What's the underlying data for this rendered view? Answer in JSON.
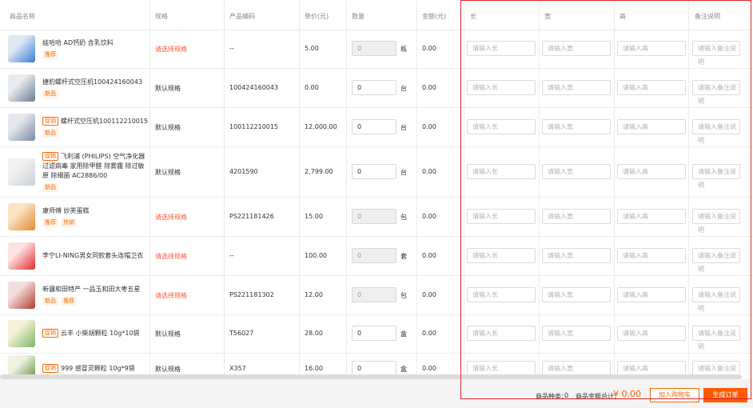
{
  "header": {
    "product_name": "商品名称",
    "spec": "规格",
    "product_code": "产品编码",
    "unit_price": "单价(元)",
    "quantity": "数量",
    "amount": "金额(元)",
    "length": "长",
    "width": "宽",
    "height": "高",
    "remark": "备注说明"
  },
  "placeholders": {
    "length": "请输入长",
    "width": "请输入宽",
    "height": "请输入高",
    "remark": "请输入备注说明"
  },
  "rows": [
    {
      "promo": "",
      "name": "娃哈哈 AD钙奶 含乳饮料",
      "badges": [
        "推荐"
      ],
      "spec": "请选择规格",
      "code": "--",
      "price": "5.00",
      "qty": "0",
      "unit": "瓶",
      "amount": "0.00"
    },
    {
      "promo": "",
      "name": "捷豹螺杆式空压机100424160043",
      "badges": [
        "新品"
      ],
      "spec": "默认规格",
      "code": "100424160043",
      "price": "0.00",
      "qty": "0",
      "unit": "台",
      "amount": "0.00"
    },
    {
      "promo": "促销",
      "name": "螺杆式空压机100112210015",
      "badges": [
        "新品"
      ],
      "spec": "默认规格",
      "code": "100112210015",
      "price": "12,000.00",
      "qty": "0",
      "unit": "台",
      "amount": "0.00"
    },
    {
      "promo": "促销",
      "name": "飞利浦 (PHILIPS) 空气净化器 过滤病毒 家用除甲醛 除雾霾 除过敏原 除细菌 AC2886/00",
      "badges": [
        "新品"
      ],
      "spec": "默认规格",
      "code": "4201590",
      "price": "2,799.00",
      "qty": "0",
      "unit": "台",
      "amount": "0.00"
    },
    {
      "promo": "",
      "name": "康师傅 妙芙蛋糕",
      "badges": [
        "推荐",
        "热销"
      ],
      "spec": "请选择规格",
      "code": "PS221181426",
      "price": "15.00",
      "qty": "0",
      "unit": "包",
      "amount": "0.00"
    },
    {
      "promo": "",
      "name": "李宁LI-NING男女同款套头连帽卫衣",
      "badges": [],
      "spec": "请选择规格",
      "code": "--",
      "price": "100.00",
      "qty": "0",
      "unit": "套",
      "amount": "0.00"
    },
    {
      "promo": "",
      "name": "新疆和田特产 一品玉和田大枣五星",
      "badges": [
        "新品",
        "推荐"
      ],
      "spec": "请选择规格",
      "code": "PS221181302",
      "price": "12.00",
      "qty": "0",
      "unit": "包",
      "amount": "0.00"
    },
    {
      "promo": "促销",
      "name": "云丰 小柴胡颗粒 10g*10袋",
      "badges": [],
      "spec": "默认规格",
      "code": "T56027",
      "price": "28.00",
      "qty": "0",
      "unit": "盒",
      "amount": "0.00"
    },
    {
      "promo": "促销",
      "name": "999 感冒灵颗粒 10g*9袋",
      "badges": [],
      "spec": "默认规格",
      "code": "X357",
      "price": "16.00",
      "qty": "0",
      "unit": "盒",
      "amount": "0.00"
    }
  ],
  "footer": {
    "kinds_label": "商品种类：",
    "kinds_value": "0",
    "total_label": "商品金额总计：",
    "total_value": "¥ 0.00",
    "add_cart": "加入购物车",
    "create_order": "生成订单"
  },
  "colors": {
    "accent": "#ff5a00",
    "highlight_border": "#e4262b"
  }
}
